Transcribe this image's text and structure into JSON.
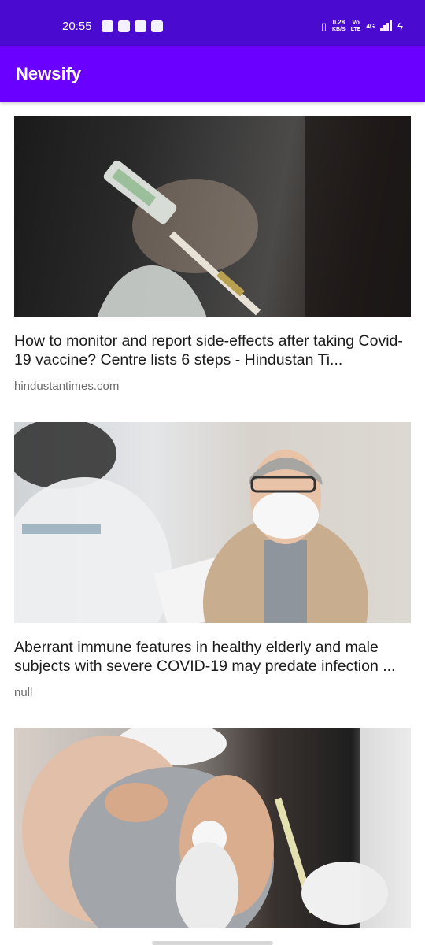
{
  "status_bar": {
    "time": "20:55",
    "net_speed": "0.28",
    "net_unit": "KB/S",
    "volte_top": "Vo",
    "volte_bottom": "LTE",
    "network": "4G"
  },
  "app_bar": {
    "title": "Newsify",
    "background_color": "#6a00ff",
    "status_color": "#4a0ad0"
  },
  "articles": [
    {
      "title": "How to monitor and report side-effects after taking Covid-19 vaccine? Centre lists 6 steps - Hindustan Ti...",
      "source": "hindustantimes.com",
      "image": "vaccine-vial-photo"
    },
    {
      "title": "Aberrant immune features in healthy elderly and male subjects with severe COVID-19 may predate infection ...",
      "source": "null",
      "image": "elderly-man-mask-photo"
    },
    {
      "title": "",
      "source": "",
      "image": "arm-vaccination-photo"
    }
  ]
}
